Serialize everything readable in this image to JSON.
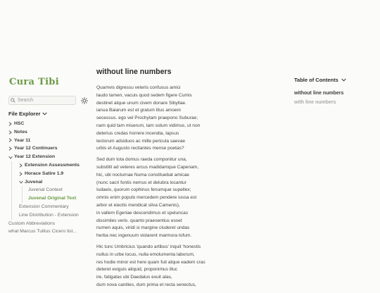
{
  "site_title": "Cura Tibi",
  "search": {
    "placeholder": "Search"
  },
  "explorer": {
    "title": "File Explorer",
    "items": [
      {
        "label": "HSC"
      },
      {
        "label": "Notes"
      },
      {
        "label": "Year 11"
      },
      {
        "label": "Year 12 Continuers"
      },
      {
        "label": "Year 12 Extension"
      },
      {
        "label": "Extension Assessments"
      },
      {
        "label": "Horace Satire 1.9"
      },
      {
        "label": "Juvenal"
      },
      {
        "label": "Juvenal Context"
      },
      {
        "label": "Juvenal Original Text"
      },
      {
        "label": "Extension Commentary"
      },
      {
        "label": "Line Distribution - Extension"
      },
      {
        "label": "Custom Abbreviations"
      },
      {
        "label": "what Marcus Tullius Cicero list..."
      }
    ]
  },
  "article": {
    "title": "without line numbers",
    "stanzas": [
      [
        "Quamvis digressu veteris confusus amici",
        "laudo tamen, vacuis quod sedem figere Cumis",
        "destinet atque unum civem donare Sibyllae.",
        "ianua Baiarum est et gratum litus amoeni",
        "secessus. ego vel Prochytam praepono Suburae;",
        "nam quid tam miserum, tam solum vidimus, ut non",
        "deterius credas horrere incendia, lapsus",
        "tectorum adsiduos ac mille pericula saevae",
        "urbis et Augusto recitantes mense poetas?"
      ],
      [
        "Sed dum tota domus raeda componitur una,",
        "substitit ad veteres arcus madidamque Capenam,",
        "hic, ubi nocturnae Numa constituebat amicae",
        "(nunc sacri fontis nemus et delubra locantur",
        "Iudaeis, quorum cophinus fenumque supellex;",
        "omnis enim populo mercedem pendere iussa est",
        "arbor et eiectis mendicat silva Camenis),",
        "in vallem Egeriae descendimus et speluncas",
        "dissimiles veris. quanto praesentius esset",
        "numen aquis, viridi si margine cluderet undas",
        "herba nec ingenuum violarent marmora tofum."
      ],
      [
        "Hic tunc Umbricius 'quando artibus' inquit 'honestis",
        "nullus in urbe locus, nulla emolumenta laborum,",
        "res hodie minor est here quam fuit atque eadem cras",
        "deteret exiguis aliquid, proponimus illuc",
        "ire, fatigatas ubi Daedalus exuit alas,",
        "dum nova canities, dum prima et recta senectus,"
      ]
    ]
  },
  "toc": {
    "title": "Table of Contents",
    "items": [
      {
        "label": "without line numbers"
      },
      {
        "label": "with line numbers"
      }
    ]
  }
}
